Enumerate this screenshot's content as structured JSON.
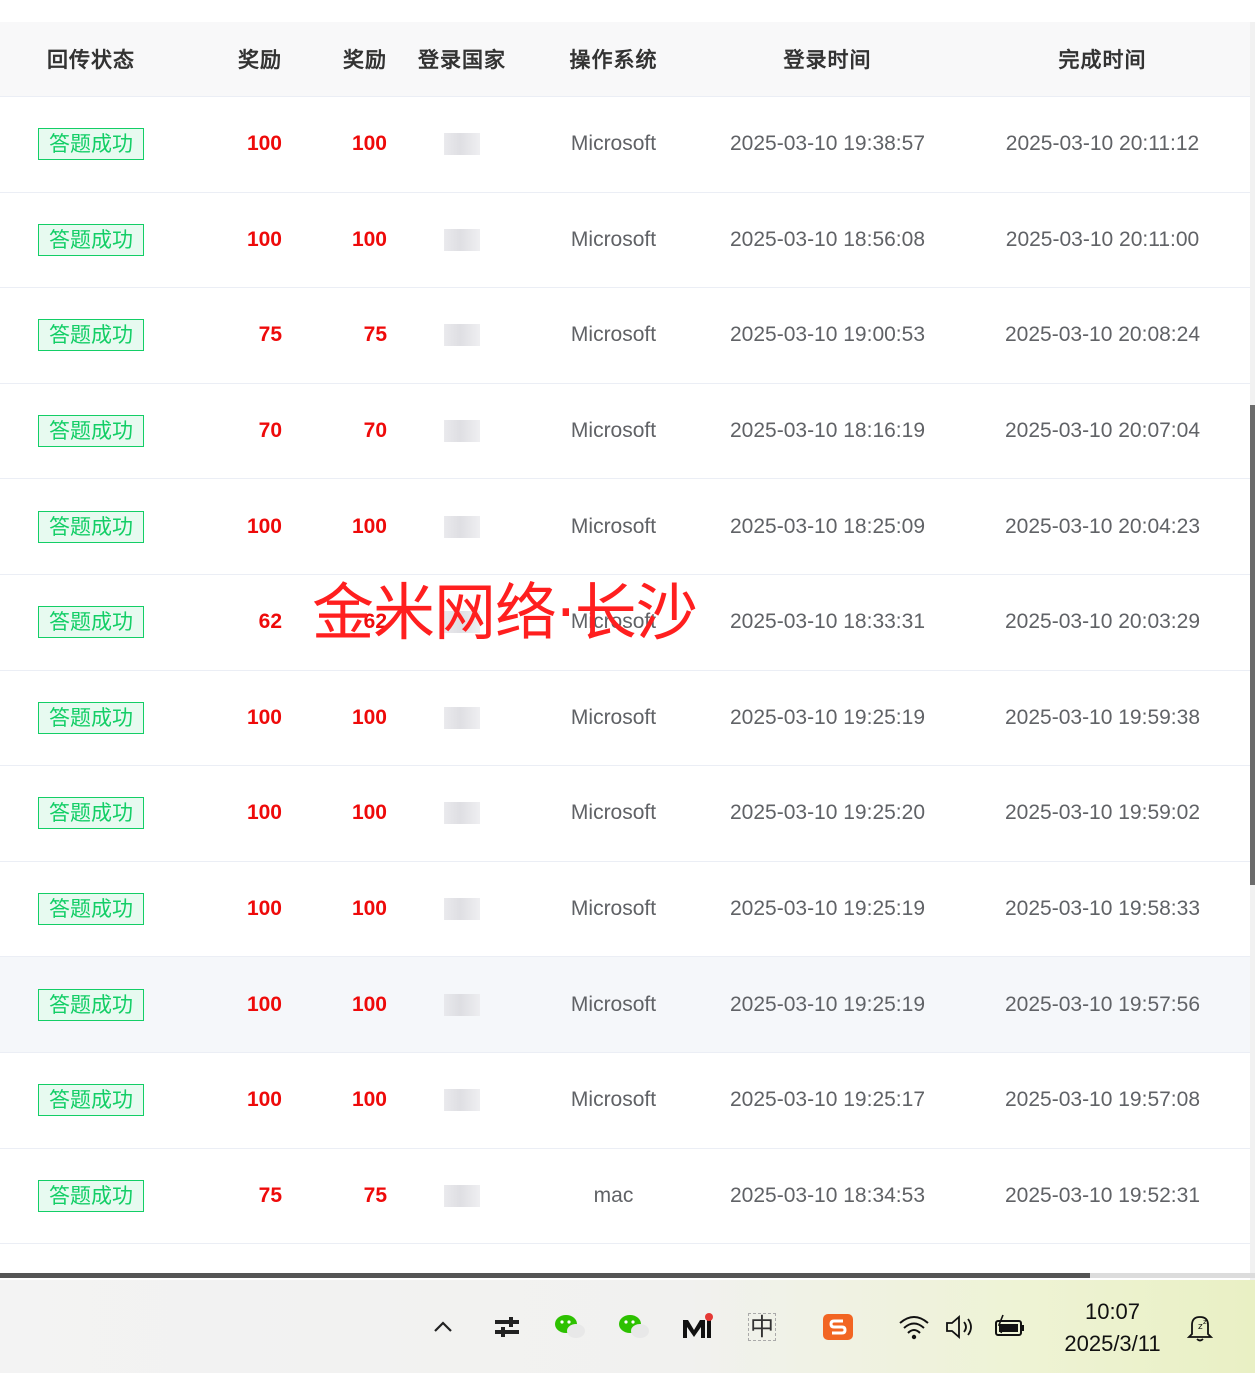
{
  "table": {
    "headers": [
      "回传状态",
      "奖励",
      "奖励",
      "登录国家",
      "操作系统",
      "登录时间",
      "完成时间"
    ],
    "rows": [
      {
        "status": "答题成功",
        "reward1": "100",
        "reward2": "100",
        "os": "Microsoft",
        "login": "2025-03-10 19:38:57",
        "done": "2025-03-10 20:11:12"
      },
      {
        "status": "答题成功",
        "reward1": "100",
        "reward2": "100",
        "os": "Microsoft",
        "login": "2025-03-10 18:56:08",
        "done": "2025-03-10 20:11:00"
      },
      {
        "status": "答题成功",
        "reward1": "75",
        "reward2": "75",
        "os": "Microsoft",
        "login": "2025-03-10 19:00:53",
        "done": "2025-03-10 20:08:24"
      },
      {
        "status": "答题成功",
        "reward1": "70",
        "reward2": "70",
        "os": "Microsoft",
        "login": "2025-03-10 18:16:19",
        "done": "2025-03-10 20:07:04"
      },
      {
        "status": "答题成功",
        "reward1": "100",
        "reward2": "100",
        "os": "Microsoft",
        "login": "2025-03-10 18:25:09",
        "done": "2025-03-10 20:04:23"
      },
      {
        "status": "答题成功",
        "reward1": "62",
        "reward2": "62",
        "os": "Microsoft",
        "login": "2025-03-10 18:33:31",
        "done": "2025-03-10 20:03:29"
      },
      {
        "status": "答题成功",
        "reward1": "100",
        "reward2": "100",
        "os": "Microsoft",
        "login": "2025-03-10 19:25:19",
        "done": "2025-03-10 19:59:38"
      },
      {
        "status": "答题成功",
        "reward1": "100",
        "reward2": "100",
        "os": "Microsoft",
        "login": "2025-03-10 19:25:20",
        "done": "2025-03-10 19:59:02"
      },
      {
        "status": "答题成功",
        "reward1": "100",
        "reward2": "100",
        "os": "Microsoft",
        "login": "2025-03-10 19:25:19",
        "done": "2025-03-10 19:58:33"
      },
      {
        "status": "答题成功",
        "reward1": "100",
        "reward2": "100",
        "os": "Microsoft",
        "login": "2025-03-10 19:25:19",
        "done": "2025-03-10 19:57:56"
      },
      {
        "status": "答题成功",
        "reward1": "100",
        "reward2": "100",
        "os": "Microsoft",
        "login": "2025-03-10 19:25:17",
        "done": "2025-03-10 19:57:08"
      },
      {
        "status": "答题成功",
        "reward1": "75",
        "reward2": "75",
        "os": "mac",
        "login": "2025-03-10 18:34:53",
        "done": "2025-03-10 19:52:31"
      }
    ]
  },
  "watermark": "金米网络·长沙",
  "taskbar": {
    "icons": [
      "chevron-up-icon",
      "sliders-icon",
      "wechat-icon",
      "wechat-icon",
      "mail-app-icon",
      "ime-zhong-icon",
      "sogou-s-icon",
      "wifi-icon",
      "volume-icon",
      "battery-icon",
      "notification-icon"
    ],
    "ime_label": "中",
    "time": "10:07",
    "date": "2025/3/11"
  },
  "colors": {
    "reward": "#ee0a0a",
    "tag": "#13ce66",
    "header_bg": "#f8f8f9"
  }
}
